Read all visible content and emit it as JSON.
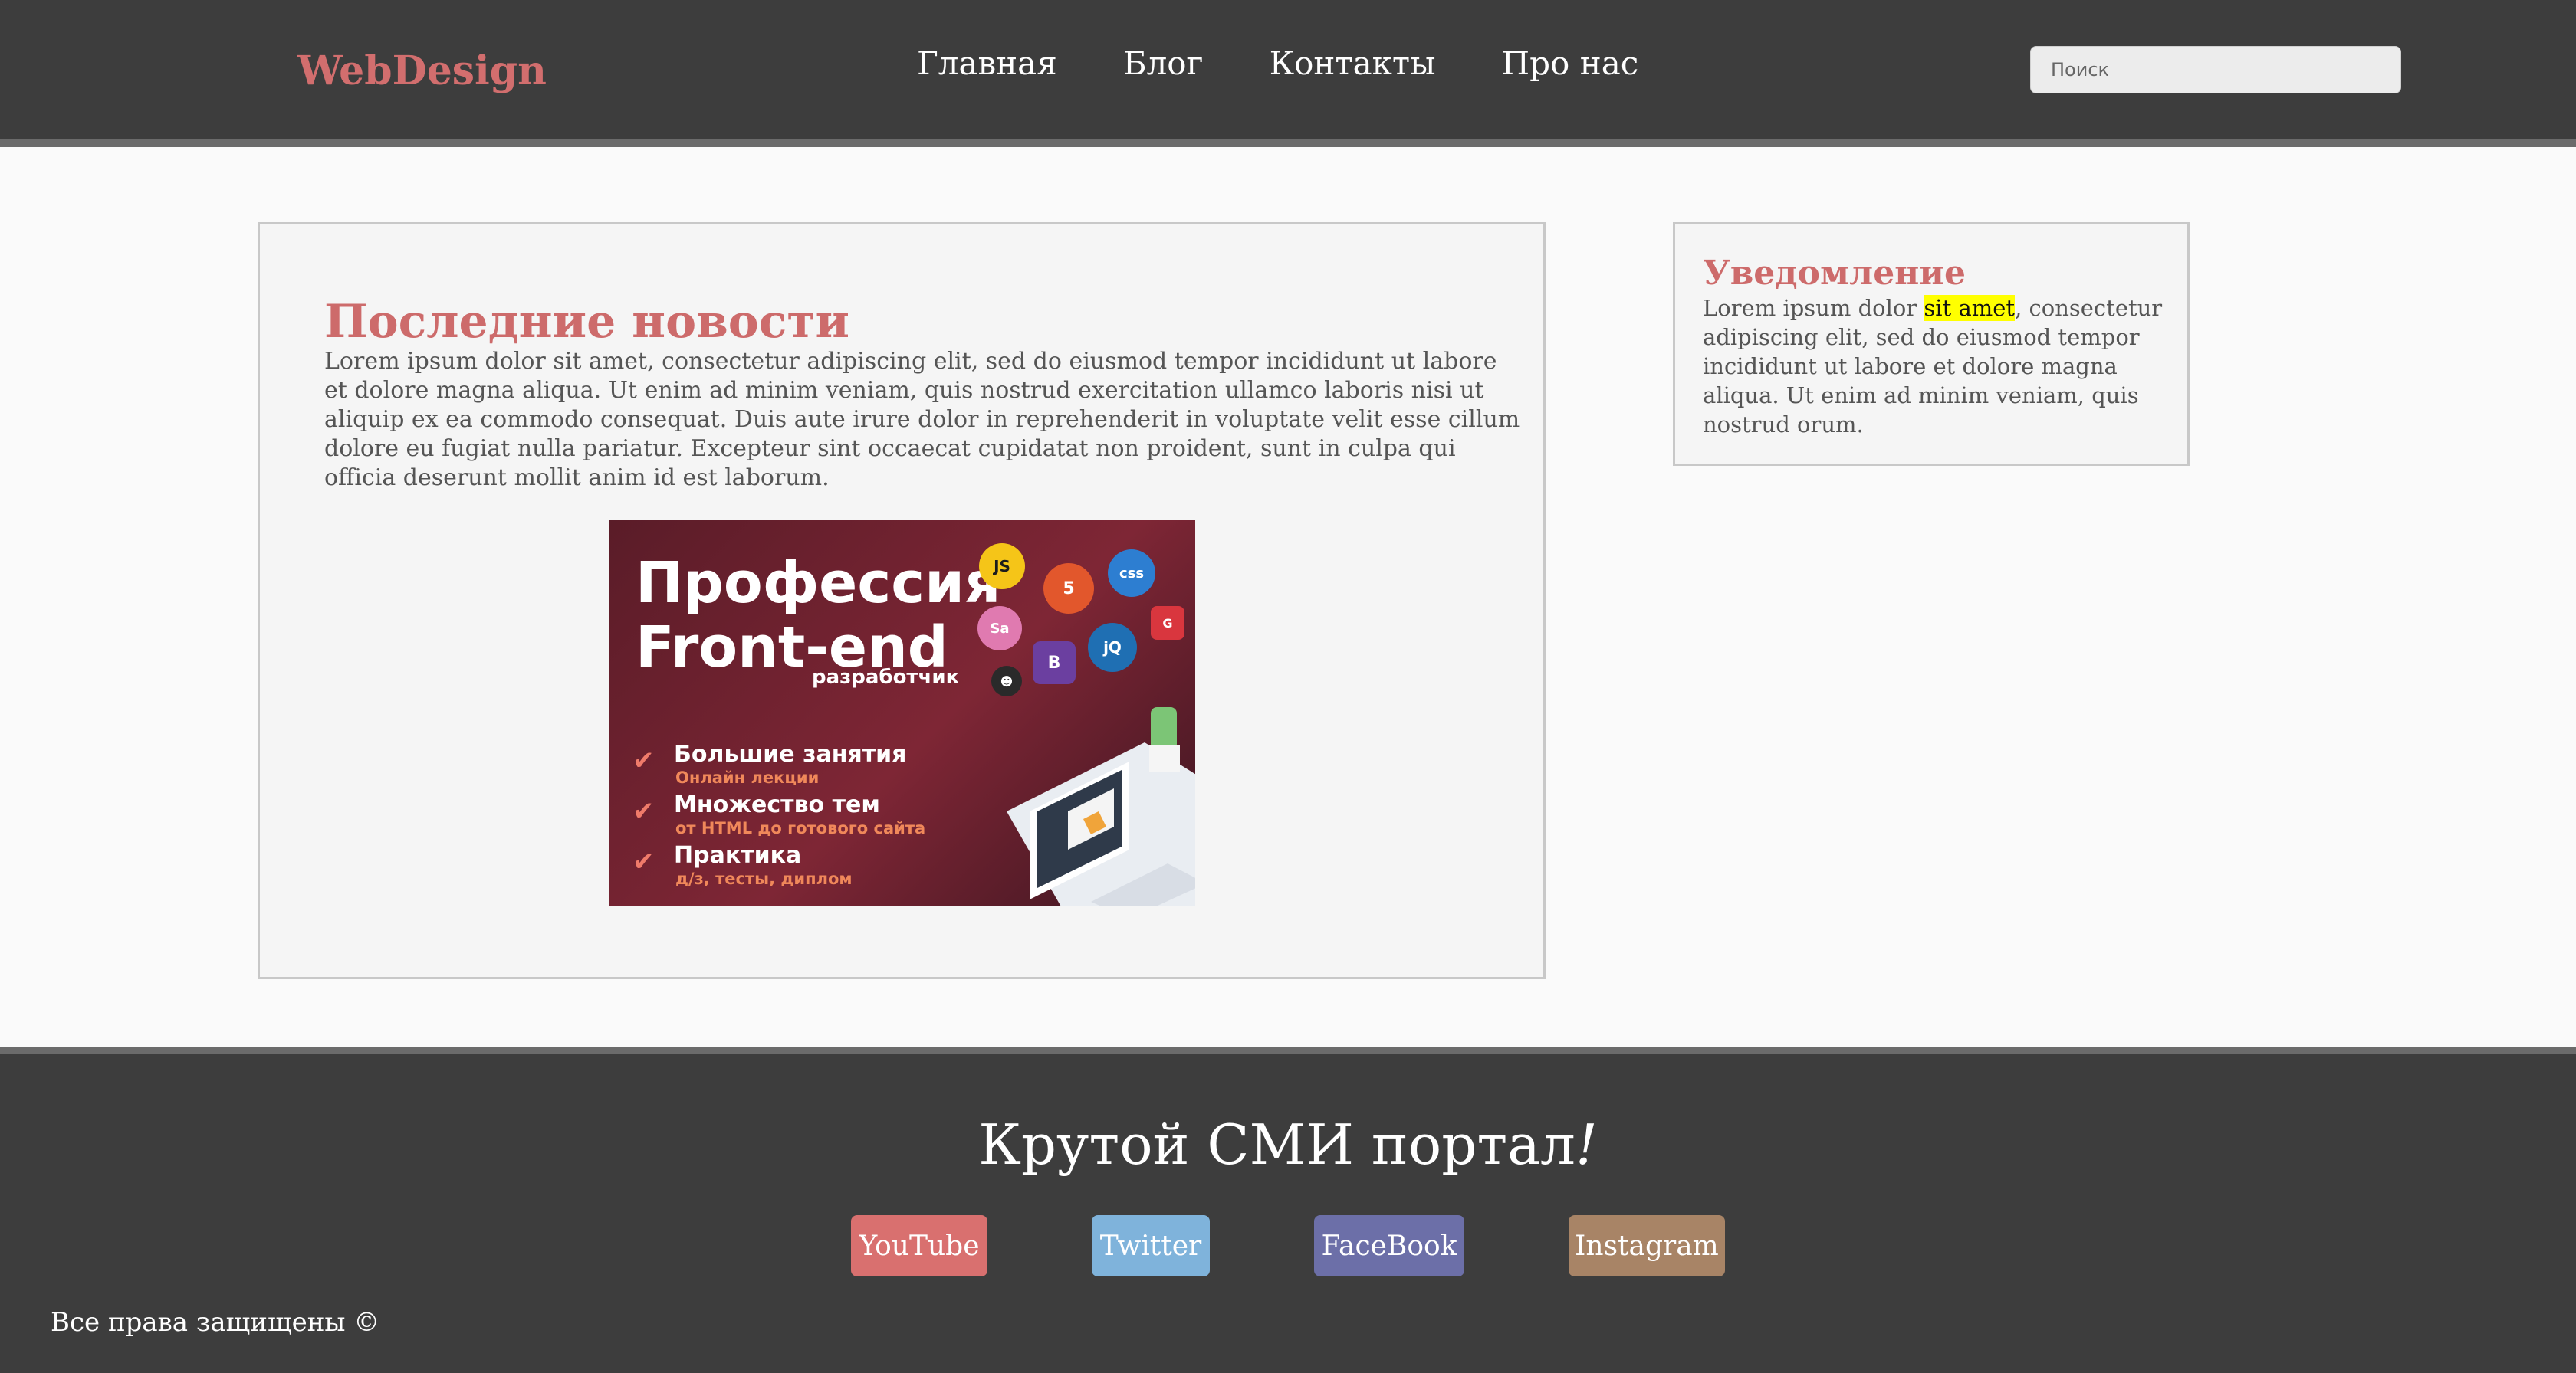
{
  "header": {
    "logo": "WebDesign",
    "nav": [
      "Главная",
      "Блог",
      "Контакты",
      "Про нас"
    ],
    "search_placeholder": "Поиск"
  },
  "main": {
    "title": "Последние новости",
    "text": "Lorem ipsum dolor sit amet, consectetur adipiscing elit, sed do eiusmod tempor incididunt ut labore et dolore magna aliqua. Ut enim ad minim veniam, quis nostrud exercitation ullamco laboris nisi ut aliquip ex ea commodo consequat. Duis aute irure dolor in reprehenderit in voluptate velit esse cillum dolore eu fugiat nulla pariatur. Excepteur sint occaecat cupidatat non proident, sunt in culpa qui officia deserunt mollit anim id est laborum.",
    "banner": {
      "title_line1": "Профессия",
      "title_line2": "Front-end",
      "subtitle": "разработчик",
      "items": [
        {
          "main": "Большие занятия",
          "small": "Онлайн лекции"
        },
        {
          "main": "Множество тем",
          "small": "от HTML до готового сайта"
        },
        {
          "main": "Практика",
          "small": "д/з, тесты, диплом"
        }
      ],
      "icons": [
        "js-icon",
        "html5-icon",
        "css3-icon",
        "sass-icon",
        "jquery-icon",
        "bootstrap-icon",
        "ninja-icon",
        "gulp-icon"
      ]
    }
  },
  "sidebar": {
    "title": "Уведомление",
    "text_before": "Lorem ipsum dolor ",
    "text_highlight": "sit amet",
    "text_after": ", consectetur adipiscing elit, sed do eiusmod tempor incididunt ut labore et dolore magna aliqua. Ut enim ad minim veniam, quis nostrud orum."
  },
  "footer": {
    "title_main": "Крутой СМИ портал",
    "title_mark": "!",
    "social": [
      {
        "label": "YouTube",
        "color": "#d9706f"
      },
      {
        "label": "Twitter",
        "color": "#7fb3db"
      },
      {
        "label": "FaceBook",
        "color": "#6c6fa8"
      },
      {
        "label": "Instagram",
        "color": "#a88466"
      }
    ],
    "copyright": "Все права защищены ©"
  },
  "colors": {
    "header_bg": "#3d3d3d",
    "accent": "#cd6b6b",
    "highlight": "#ffff00"
  }
}
